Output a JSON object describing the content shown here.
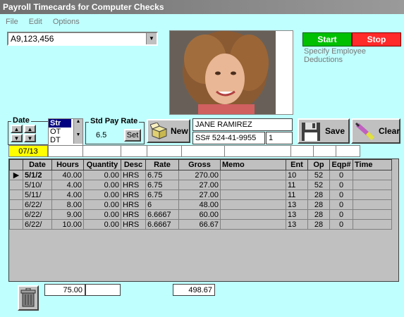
{
  "window": {
    "title": "Payroll Timecards for Computer Checks"
  },
  "menu": [
    "File",
    "Edit",
    "Options"
  ],
  "employee_combo": {
    "value": "A9,123,456"
  },
  "start_label": "Start",
  "stop_label": "Stop",
  "deductions_label": "Specify Employee Deductions",
  "date_group": {
    "label": "Date",
    "value": "07/13"
  },
  "type_list": {
    "items": [
      "Str",
      "OT",
      "DT"
    ],
    "selected": "Str"
  },
  "std_pay": {
    "label": "Std Pay Rate",
    "value": "6.5",
    "set_label": "Set"
  },
  "new_label": "New",
  "employee": {
    "name": "JANE RAMIREZ",
    "ssn": "SS# 524-41-9955",
    "num": "1"
  },
  "save_label": "Save",
  "clear_label": "Clear",
  "table": {
    "columns": [
      "Date",
      "Hours",
      "Quantity",
      "Desc",
      "Rate",
      "Gross",
      "Memo",
      "Ent",
      "Op",
      "Eqp#",
      "Time"
    ],
    "rows": [
      [
        "5/1/2",
        "40.00",
        "0.00",
        "HRS",
        "6.75",
        "270.00",
        "",
        "10",
        "52",
        "0",
        ""
      ],
      [
        "5/10/",
        "4.00",
        "0.00",
        "HRS",
        "6.75",
        "27.00",
        "",
        "11",
        "52",
        "0",
        ""
      ],
      [
        "5/11/",
        "4.00",
        "0.00",
        "HRS",
        "6.75",
        "27.00",
        "",
        "11",
        "28",
        "0",
        ""
      ],
      [
        "6/22/",
        "8.00",
        "0.00",
        "HRS",
        "6",
        "48.00",
        "",
        "13",
        "28",
        "0",
        ""
      ],
      [
        "6/22/",
        "9.00",
        "0.00",
        "HRS",
        "6.6667",
        "60.00",
        "",
        "13",
        "28",
        "0",
        ""
      ],
      [
        "6/22/",
        "10.00",
        "0.00",
        "HRS",
        "6.6667",
        "66.67",
        "",
        "13",
        "28",
        "0",
        ""
      ]
    ]
  },
  "totals": {
    "hours": "75.00",
    "gross": "498.67"
  },
  "icons": {
    "trash": "trash-can-icon",
    "new": "open-box-icon",
    "save": "floppy-disk-icon",
    "clear": "eraser-icon"
  },
  "colors": {
    "background": "#bffffe",
    "start": "#00c000",
    "stop": "#ff2a2a",
    "date_highlight": "#ffff00"
  }
}
